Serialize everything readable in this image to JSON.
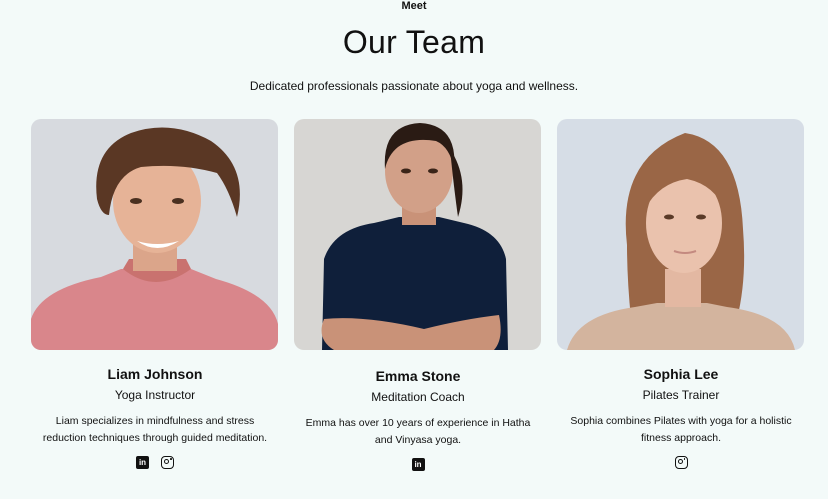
{
  "section": {
    "eyebrow": "Meet",
    "title": "Our Team",
    "subtitle": "Dedicated professionals passionate about yoga and wellness."
  },
  "team": [
    {
      "name": "Liam Johnson",
      "role": "Yoga Instructor",
      "bio": "Liam specializes in mindfulness and stress reduction techniques through guided meditation.",
      "socials": [
        "linkedin-icon",
        "instagram-icon"
      ]
    },
    {
      "name": "Emma Stone",
      "role": "Meditation Coach",
      "bio": "Emma has over 10 years of experience in Hatha and Vinyasa yoga.",
      "socials": [
        "linkedin-icon"
      ]
    },
    {
      "name": "Sophia Lee",
      "role": "Pilates Trainer",
      "bio": "Sophia combines Pilates with yoga for a holistic fitness approach.",
      "socials": [
        "instagram-icon"
      ]
    }
  ],
  "colors": {
    "page_background": "#f3faf9",
    "text": "#111111"
  },
  "icon_glyphs": {
    "linkedin": "in"
  }
}
